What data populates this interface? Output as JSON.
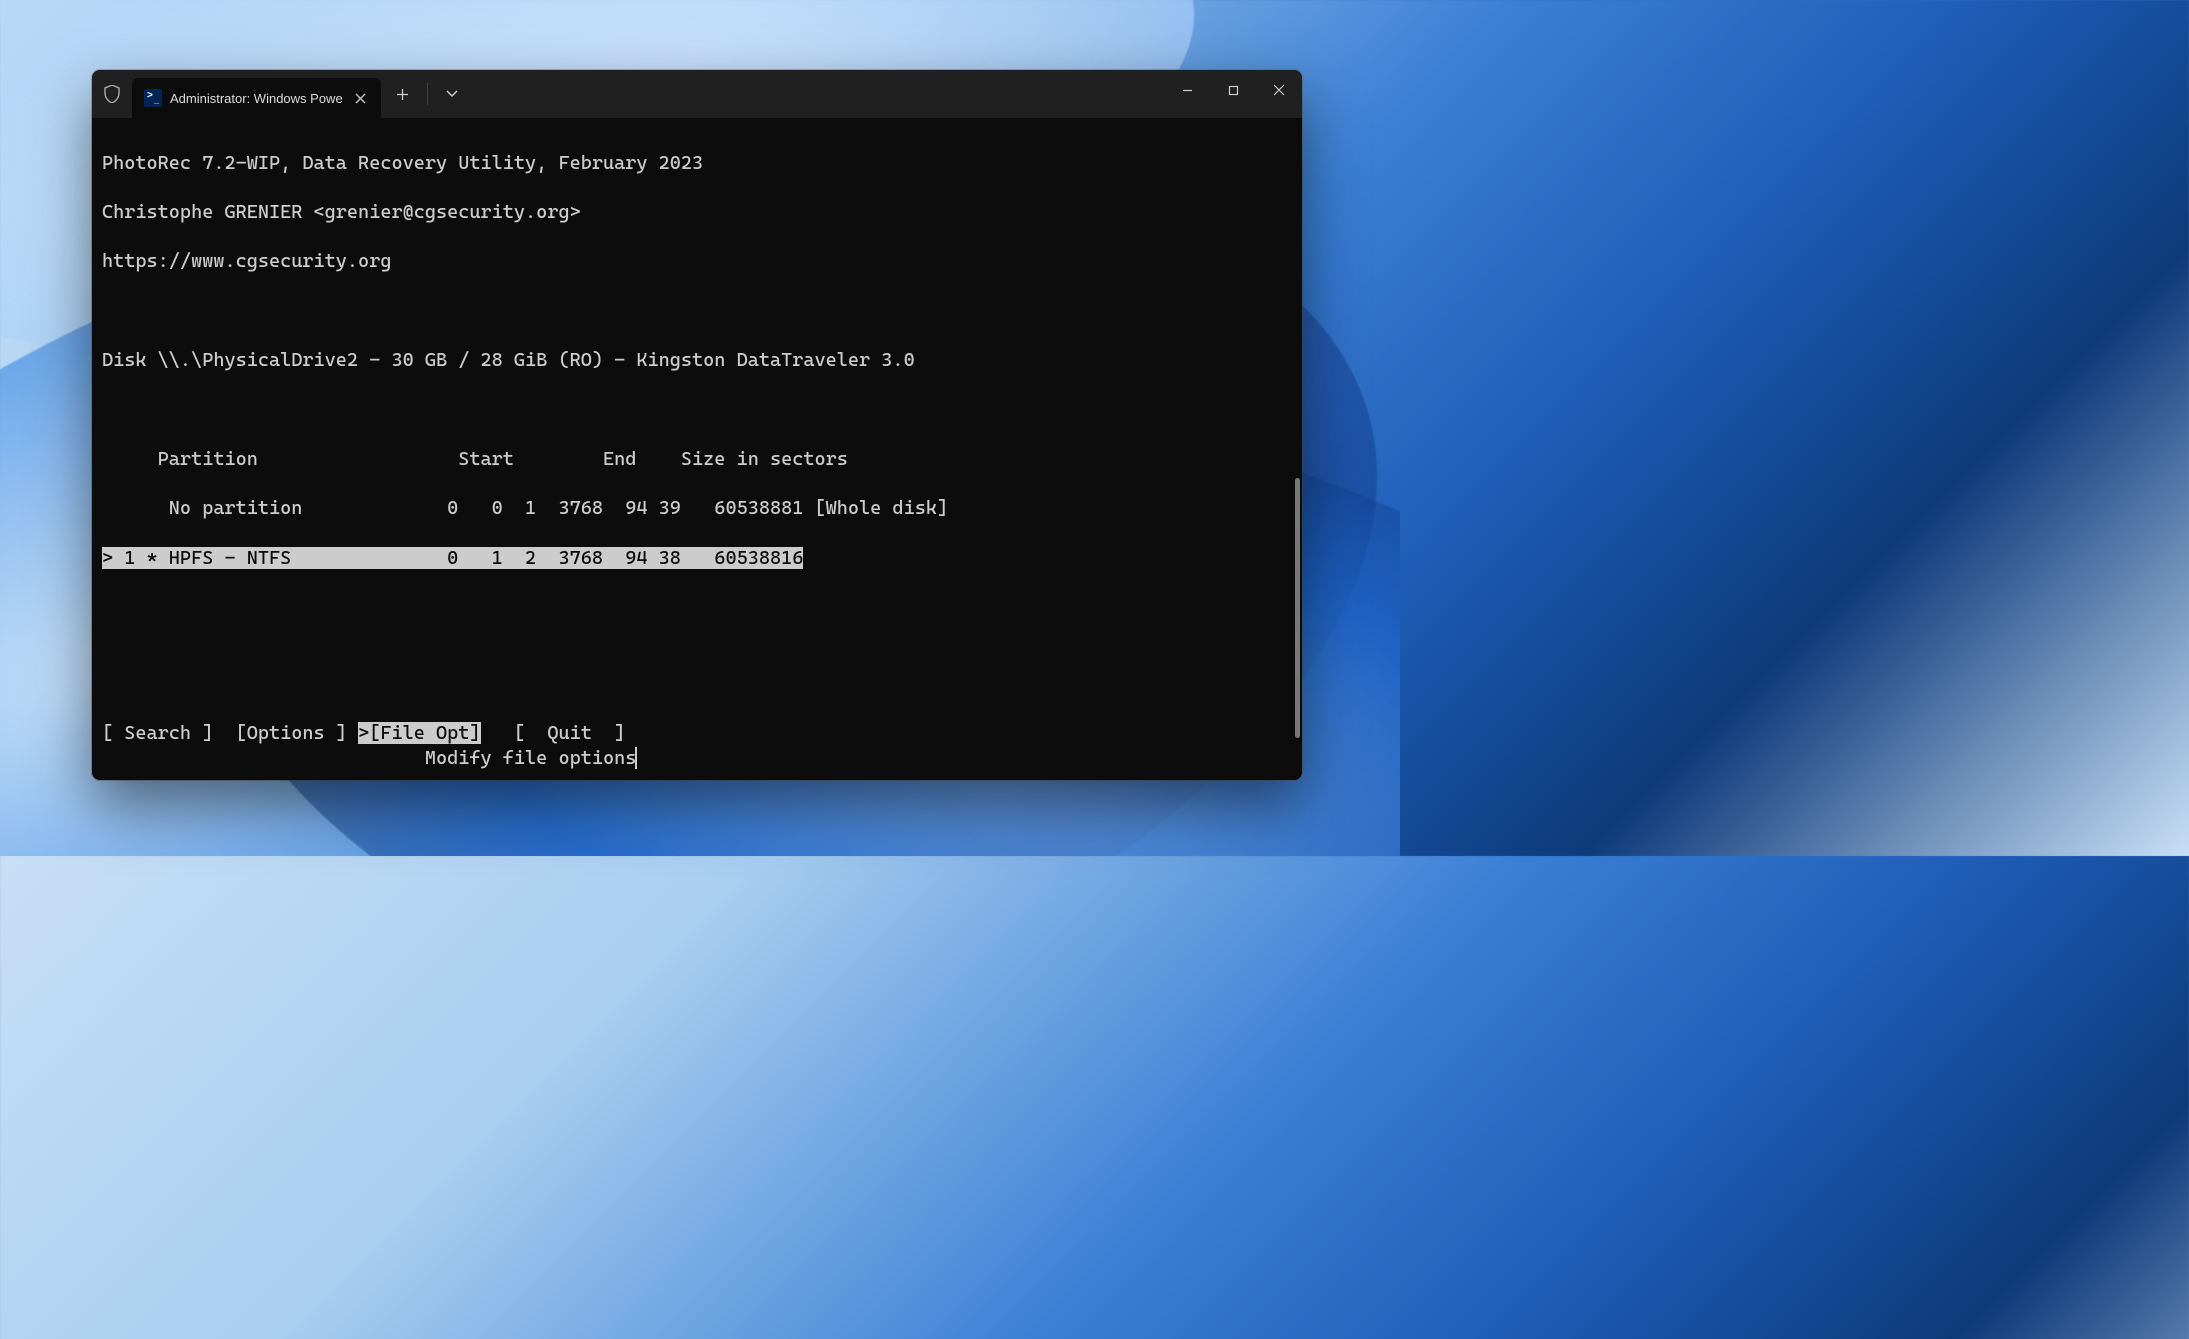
{
  "window": {
    "tab_title": "Administrator: Windows Powe"
  },
  "photorec": {
    "header_line": "PhotoRec 7.2-WIP, Data Recovery Utility, February 2023",
    "author_line": "Christophe GRENIER <grenier@cgsecurity.org>",
    "url_line": "https://www.cgsecurity.org",
    "disk_line": "Disk \\\\.\\PhysicalDrive2 - 30 GB / 28 GiB (RO) - Kingston DataTraveler 3.0",
    "table_header": "     Partition                  Start        End    Size in sectors",
    "rows": [
      "      No partition             0   0  1  3768  94 39   60538881 [Whole disk]",
      "> 1 * HPFS - NTFS              0   1  2  3768  94 38   60538816"
    ],
    "menu": {
      "prefix": "[ Search ]  [Options ] ",
      "selected": ">[File Opt]",
      "suffix": "   [  Quit  ]"
    },
    "hint": "                             Modify file options"
  }
}
